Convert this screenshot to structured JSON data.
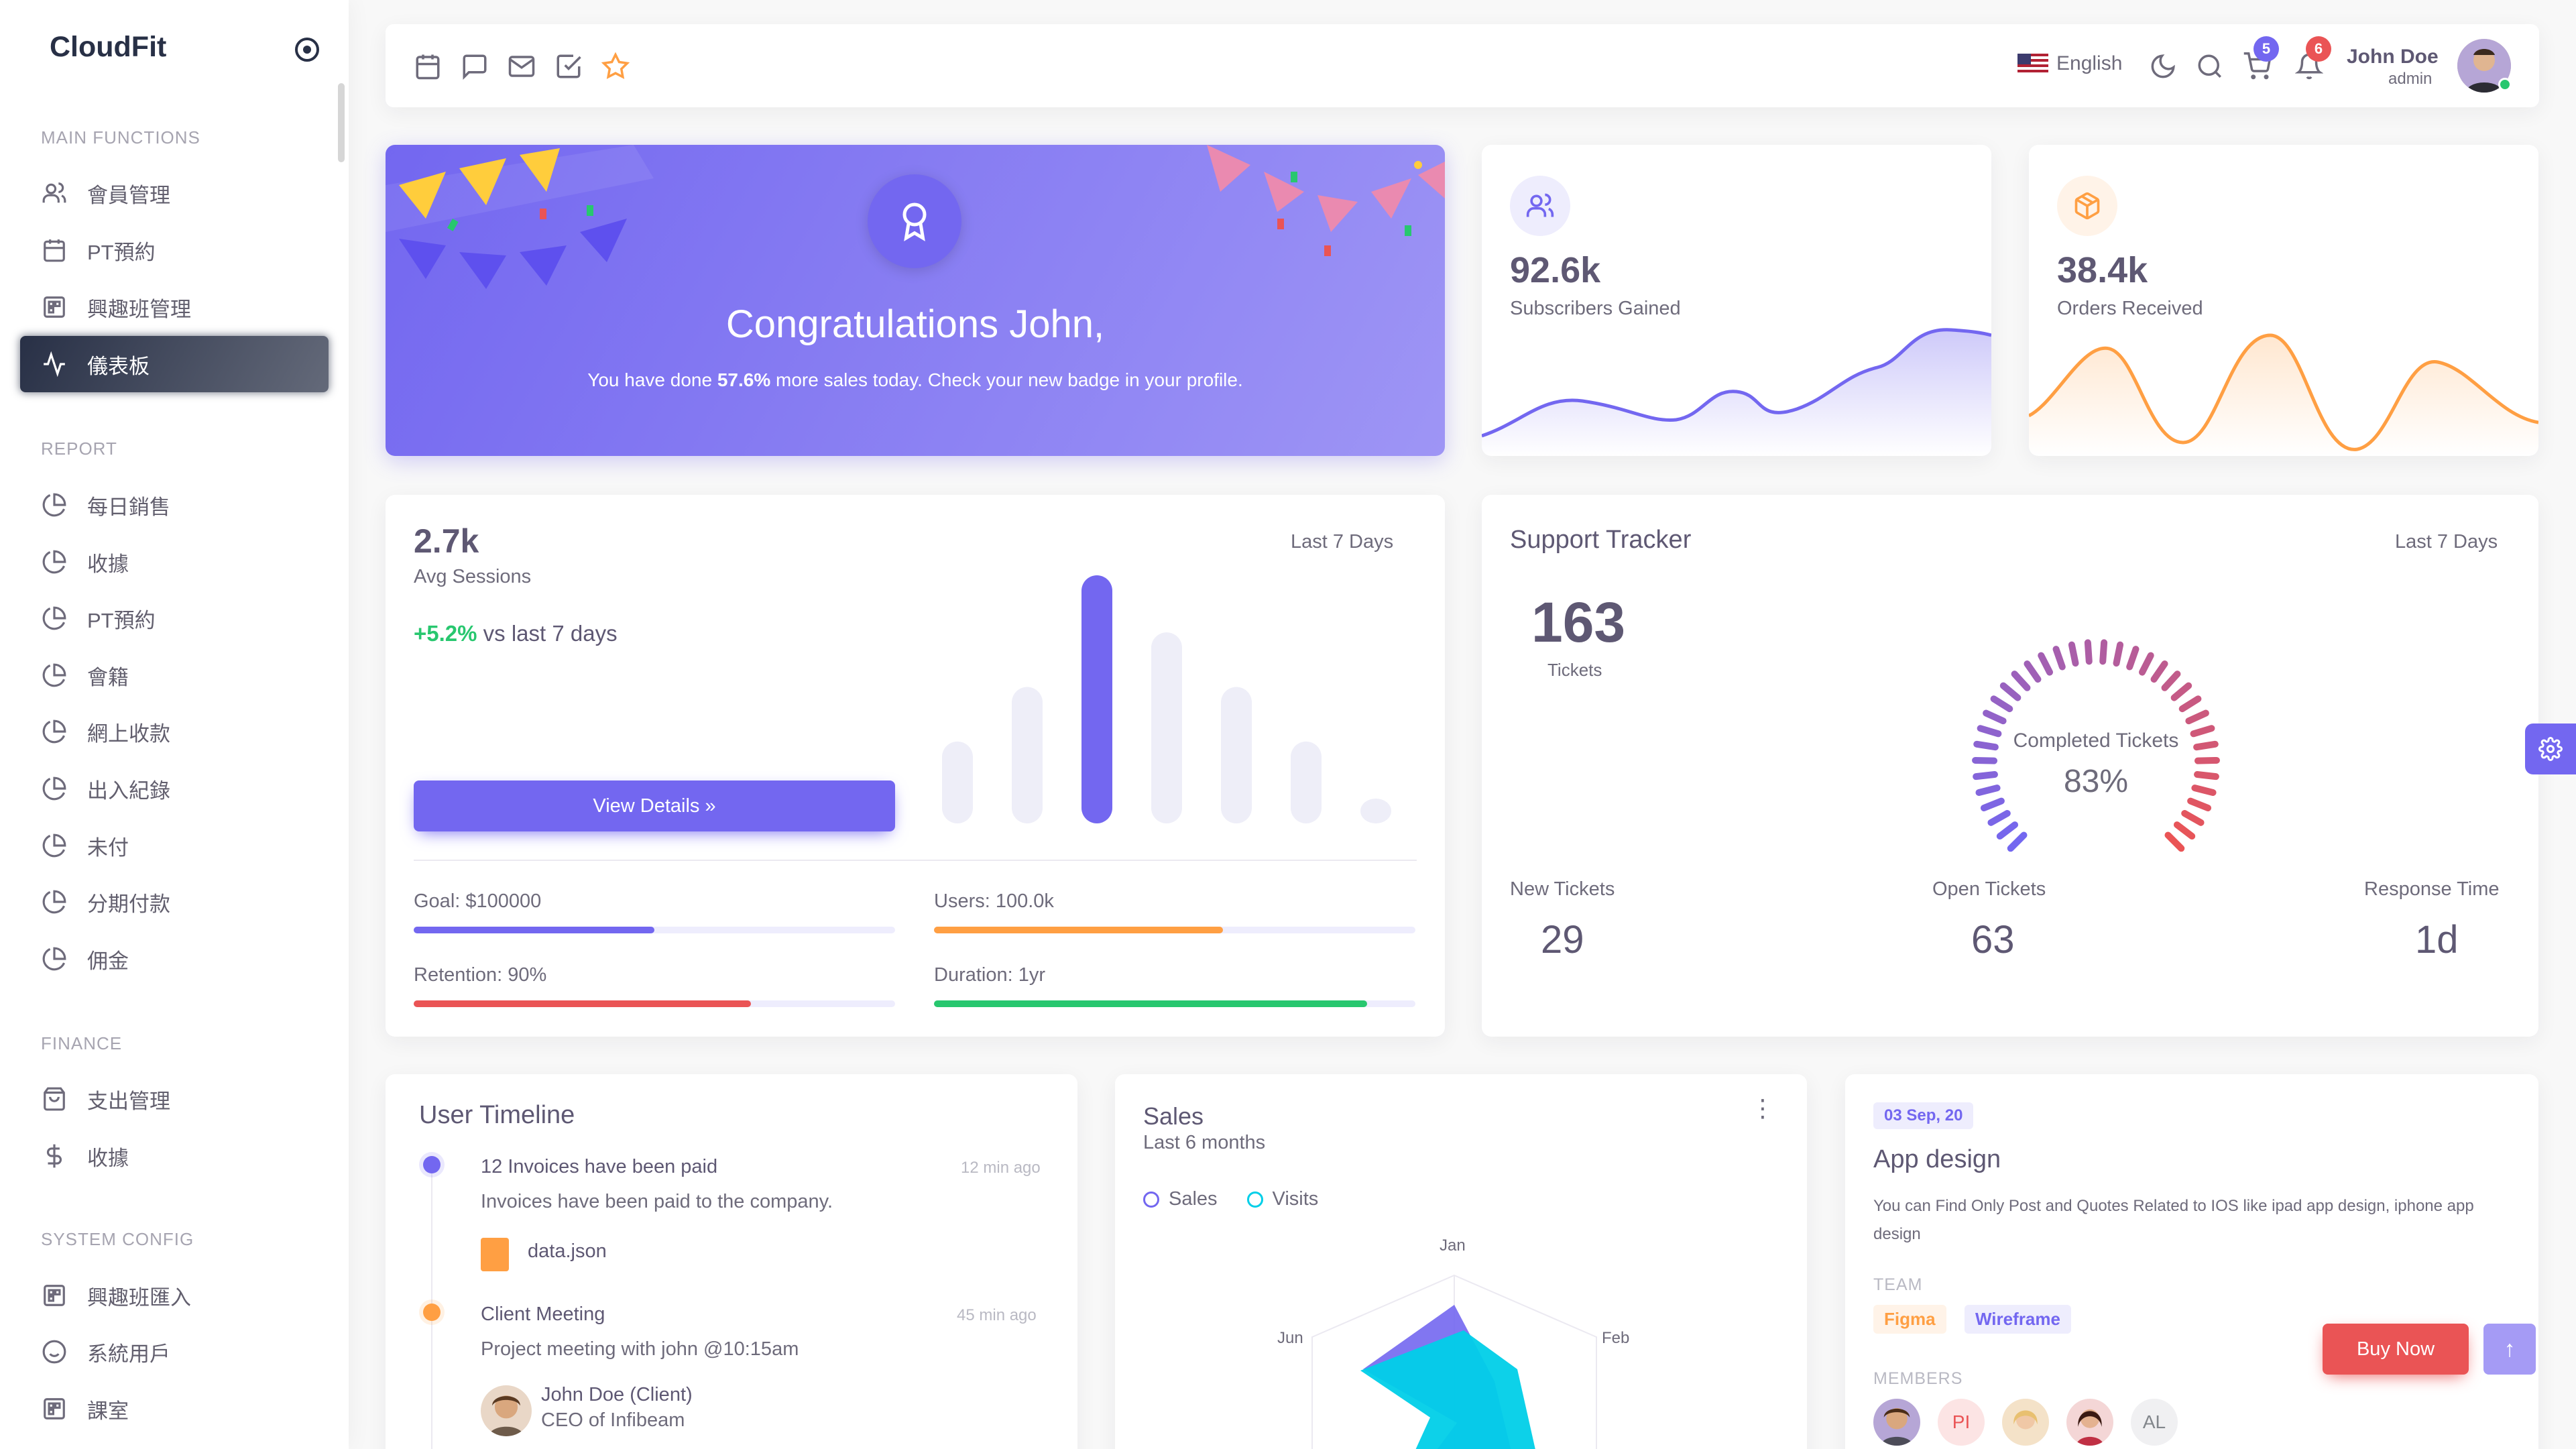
{
  "sidebar": {
    "brand": "CloudFit",
    "sections": [
      "MAIN FUNCTIONS",
      "REPORT",
      "FINANCE",
      "SYSTEM CONFIG"
    ],
    "main": [
      "會員管理",
      "PT預約",
      "興趣班管理",
      "儀表板"
    ],
    "report": [
      "每日銷售",
      "收據",
      "PT預約",
      "會籍",
      "網上收款",
      "出入紀錄",
      "未付",
      "分期付款",
      "佣金"
    ],
    "finance": [
      "支出管理",
      "收據"
    ],
    "system": [
      "興趣班匯入",
      "系統用戶",
      "課室"
    ]
  },
  "topbar": {
    "language": "English",
    "cart_count": "5",
    "notif_count": "6",
    "user_name": "John Doe",
    "user_role": "admin"
  },
  "congrats": {
    "title": "Congratulations John,",
    "text_before": "You have done ",
    "highlight": "57.6%",
    "text_after": " more sales today. Check your new badge in your profile."
  },
  "subscribers": {
    "value": "92.6k",
    "label": "Subscribers Gained"
  },
  "orders": {
    "value": "38.4k",
    "label": "Orders Received"
  },
  "sessions": {
    "value": "2.7k",
    "label": "Avg Sessions",
    "period": "Last 7 Days",
    "change": "+5.2%",
    "change_label": "vs last 7 days",
    "button": "View Details »",
    "bars": [
      0.33,
      0.55,
      1.0,
      0.77,
      0.55,
      0.33,
      0.1
    ],
    "goal": "Goal: $100000",
    "goal_pct": 0.5,
    "users": "Users: 100.0k",
    "users_pct": 0.6,
    "retention": "Retention: 90%",
    "retention_pct": 0.7,
    "duration": "Duration: 1yr",
    "duration_pct": 0.9
  },
  "support": {
    "title": "Support Tracker",
    "period": "Last 7 Days",
    "tickets": "163",
    "tickets_label": "Tickets",
    "completed_label": "Completed Tickets",
    "completed_pct": "83%",
    "new_label": "New Tickets",
    "new_value": "29",
    "open_label": "Open Tickets",
    "open_value": "63",
    "response_label": "Response Time",
    "response_value": "1d"
  },
  "timeline": {
    "title": "User Timeline",
    "item1_title": "12 Invoices have been paid",
    "item1_time": "12 min ago",
    "item1_text": "Invoices have been paid to the company.",
    "item1_file": "data.json",
    "item2_title": "Client Meeting",
    "item2_time": "45 min ago",
    "item2_text": "Project meeting with john @10:15am",
    "item2_person": "John Doe (Client)",
    "item2_role": "CEO of Infibeam"
  },
  "sales": {
    "title": "Sales",
    "subtitle": "Last 6 months",
    "legend_sales": "Sales",
    "legend_visits": "Visits",
    "axis_jan": "Jan",
    "axis_feb": "Feb",
    "axis_jun": "Jun"
  },
  "app": {
    "date": "03 Sep, 20",
    "title": "App design",
    "desc": "You can Find Only Post and Quotes Related to IOS like ipad app design, iphone app design",
    "team_label": "TEAM",
    "tag1": "Figma",
    "tag2": "Wireframe",
    "members_label": "MEMBERS",
    "m_pi": "PI",
    "m_al": "AL",
    "buy": "Buy Now"
  },
  "colors": {
    "primary": "#7367f0",
    "warning": "#ff9f43",
    "danger": "#ea5455",
    "success": "#28c76f",
    "info": "#00cfe8"
  }
}
